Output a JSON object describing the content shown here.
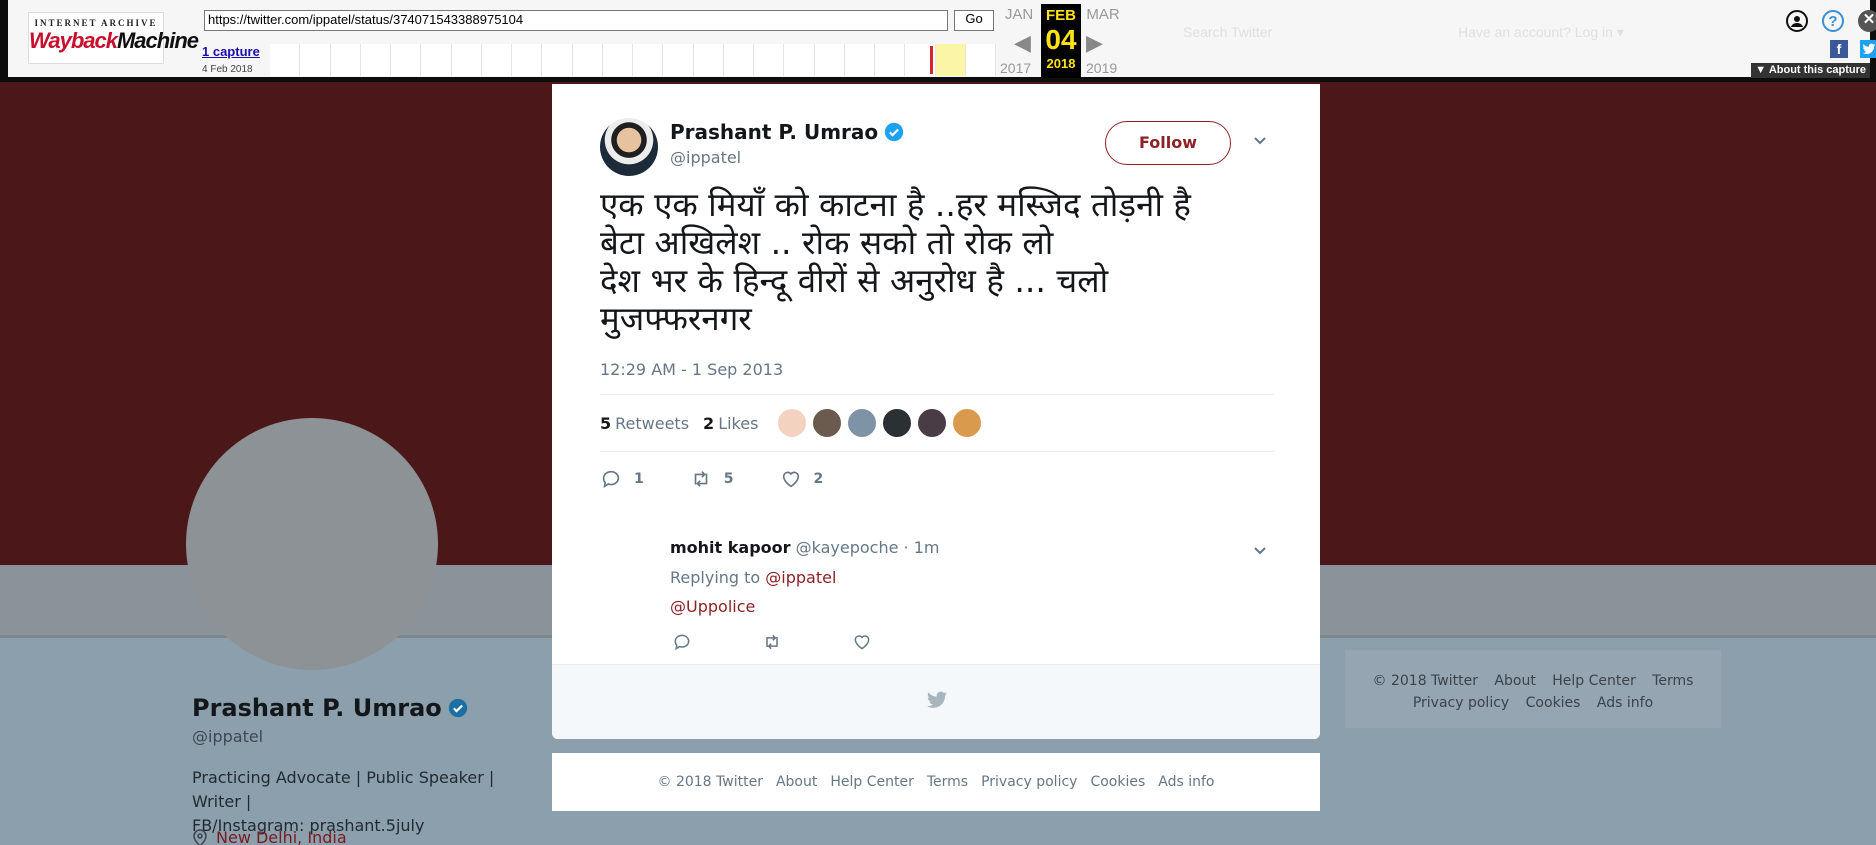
{
  "wayback": {
    "logo_top": "INTERNET ARCHIVE",
    "logo_main_a": "Wayback",
    "logo_main_b": "Machine",
    "url": "https://twitter.com/ippatel/status/374071543388975104",
    "go_label": "Go",
    "captures_link": "1 capture",
    "capture_date": "4 Feb 2018",
    "prev_month": "JAN",
    "current_month": "FEB",
    "next_month": "MAR",
    "current_day": "04",
    "prev_year": "2017",
    "current_year": "2018",
    "next_year": "2019",
    "about_capture": "▼ About this capture",
    "ghost_search": "Search Twitter",
    "ghost_account": "Have an account? Log in ▾"
  },
  "profile": {
    "name": "Prashant P. Umrao",
    "handle": "@ippatel",
    "bio_line1": "Practicing Advocate | Public Speaker | Writer |",
    "bio_line2": "FB/Instagram: prashant.5july",
    "location": "New Delhi, India"
  },
  "side_footer": {
    "links_row1": [
      "© 2018 Twitter",
      "About",
      "Help Center",
      "Terms"
    ],
    "links_row2": [
      "Privacy policy",
      "Cookies",
      "Ads info"
    ]
  },
  "tweet": {
    "author_name": "Prashant P. Umrao",
    "author_handle": "@ippatel",
    "follow_label": "Follow",
    "text_lines": [
      "एक एक मियाँ को काटना है ..हर मस्जिद तोड़नी है",
      "बेटा अखिलेश .. रोक सको तो रोक लो",
      "देश भर के हिन्दू वीरों से अनुरोध है ... चलो",
      "मुजफ्फरनगर"
    ],
    "timestamp": "12:29 AM - 1 Sep 2013",
    "retweets_count": "5",
    "retweets_label": "Retweets",
    "likes_count": "2",
    "likes_label": "Likes",
    "reply_count": "1",
    "retweet_action_count": "5",
    "like_action_count": "2",
    "colors": {
      "accent": "#8e2125",
      "verified": "#1da1f2",
      "muted": "#657786"
    }
  },
  "reply": {
    "name": "mohit kapoor",
    "handle_time": "@kayepoche · 1m",
    "replying_to_label": "Replying to",
    "replying_to_handle": "@ippatel",
    "body": "@Uppolice"
  },
  "footer": {
    "links": [
      "© 2018 Twitter",
      "About",
      "Help Center",
      "Terms",
      "Privacy policy",
      "Cookies",
      "Ads info"
    ]
  }
}
